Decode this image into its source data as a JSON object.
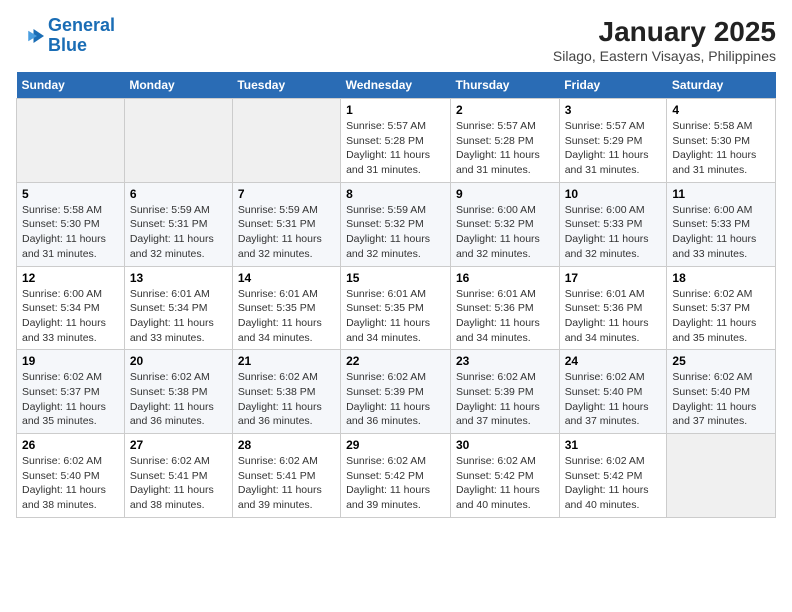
{
  "header": {
    "logo_line1": "General",
    "logo_line2": "Blue",
    "title": "January 2025",
    "subtitle": "Silago, Eastern Visayas, Philippines"
  },
  "days_of_week": [
    "Sunday",
    "Monday",
    "Tuesday",
    "Wednesday",
    "Thursday",
    "Friday",
    "Saturday"
  ],
  "weeks": [
    [
      {
        "num": "",
        "info": ""
      },
      {
        "num": "",
        "info": ""
      },
      {
        "num": "",
        "info": ""
      },
      {
        "num": "1",
        "info": "Sunrise: 5:57 AM\nSunset: 5:28 PM\nDaylight: 11 hours and 31 minutes."
      },
      {
        "num": "2",
        "info": "Sunrise: 5:57 AM\nSunset: 5:28 PM\nDaylight: 11 hours and 31 minutes."
      },
      {
        "num": "3",
        "info": "Sunrise: 5:57 AM\nSunset: 5:29 PM\nDaylight: 11 hours and 31 minutes."
      },
      {
        "num": "4",
        "info": "Sunrise: 5:58 AM\nSunset: 5:30 PM\nDaylight: 11 hours and 31 minutes."
      }
    ],
    [
      {
        "num": "5",
        "info": "Sunrise: 5:58 AM\nSunset: 5:30 PM\nDaylight: 11 hours and 31 minutes."
      },
      {
        "num": "6",
        "info": "Sunrise: 5:59 AM\nSunset: 5:31 PM\nDaylight: 11 hours and 32 minutes."
      },
      {
        "num": "7",
        "info": "Sunrise: 5:59 AM\nSunset: 5:31 PM\nDaylight: 11 hours and 32 minutes."
      },
      {
        "num": "8",
        "info": "Sunrise: 5:59 AM\nSunset: 5:32 PM\nDaylight: 11 hours and 32 minutes."
      },
      {
        "num": "9",
        "info": "Sunrise: 6:00 AM\nSunset: 5:32 PM\nDaylight: 11 hours and 32 minutes."
      },
      {
        "num": "10",
        "info": "Sunrise: 6:00 AM\nSunset: 5:33 PM\nDaylight: 11 hours and 32 minutes."
      },
      {
        "num": "11",
        "info": "Sunrise: 6:00 AM\nSunset: 5:33 PM\nDaylight: 11 hours and 33 minutes."
      }
    ],
    [
      {
        "num": "12",
        "info": "Sunrise: 6:00 AM\nSunset: 5:34 PM\nDaylight: 11 hours and 33 minutes."
      },
      {
        "num": "13",
        "info": "Sunrise: 6:01 AM\nSunset: 5:34 PM\nDaylight: 11 hours and 33 minutes."
      },
      {
        "num": "14",
        "info": "Sunrise: 6:01 AM\nSunset: 5:35 PM\nDaylight: 11 hours and 34 minutes."
      },
      {
        "num": "15",
        "info": "Sunrise: 6:01 AM\nSunset: 5:35 PM\nDaylight: 11 hours and 34 minutes."
      },
      {
        "num": "16",
        "info": "Sunrise: 6:01 AM\nSunset: 5:36 PM\nDaylight: 11 hours and 34 minutes."
      },
      {
        "num": "17",
        "info": "Sunrise: 6:01 AM\nSunset: 5:36 PM\nDaylight: 11 hours and 34 minutes."
      },
      {
        "num": "18",
        "info": "Sunrise: 6:02 AM\nSunset: 5:37 PM\nDaylight: 11 hours and 35 minutes."
      }
    ],
    [
      {
        "num": "19",
        "info": "Sunrise: 6:02 AM\nSunset: 5:37 PM\nDaylight: 11 hours and 35 minutes."
      },
      {
        "num": "20",
        "info": "Sunrise: 6:02 AM\nSunset: 5:38 PM\nDaylight: 11 hours and 36 minutes."
      },
      {
        "num": "21",
        "info": "Sunrise: 6:02 AM\nSunset: 5:38 PM\nDaylight: 11 hours and 36 minutes."
      },
      {
        "num": "22",
        "info": "Sunrise: 6:02 AM\nSunset: 5:39 PM\nDaylight: 11 hours and 36 minutes."
      },
      {
        "num": "23",
        "info": "Sunrise: 6:02 AM\nSunset: 5:39 PM\nDaylight: 11 hours and 37 minutes."
      },
      {
        "num": "24",
        "info": "Sunrise: 6:02 AM\nSunset: 5:40 PM\nDaylight: 11 hours and 37 minutes."
      },
      {
        "num": "25",
        "info": "Sunrise: 6:02 AM\nSunset: 5:40 PM\nDaylight: 11 hours and 37 minutes."
      }
    ],
    [
      {
        "num": "26",
        "info": "Sunrise: 6:02 AM\nSunset: 5:40 PM\nDaylight: 11 hours and 38 minutes."
      },
      {
        "num": "27",
        "info": "Sunrise: 6:02 AM\nSunset: 5:41 PM\nDaylight: 11 hours and 38 minutes."
      },
      {
        "num": "28",
        "info": "Sunrise: 6:02 AM\nSunset: 5:41 PM\nDaylight: 11 hours and 39 minutes."
      },
      {
        "num": "29",
        "info": "Sunrise: 6:02 AM\nSunset: 5:42 PM\nDaylight: 11 hours and 39 minutes."
      },
      {
        "num": "30",
        "info": "Sunrise: 6:02 AM\nSunset: 5:42 PM\nDaylight: 11 hours and 40 minutes."
      },
      {
        "num": "31",
        "info": "Sunrise: 6:02 AM\nSunset: 5:42 PM\nDaylight: 11 hours and 40 minutes."
      },
      {
        "num": "",
        "info": ""
      }
    ]
  ]
}
